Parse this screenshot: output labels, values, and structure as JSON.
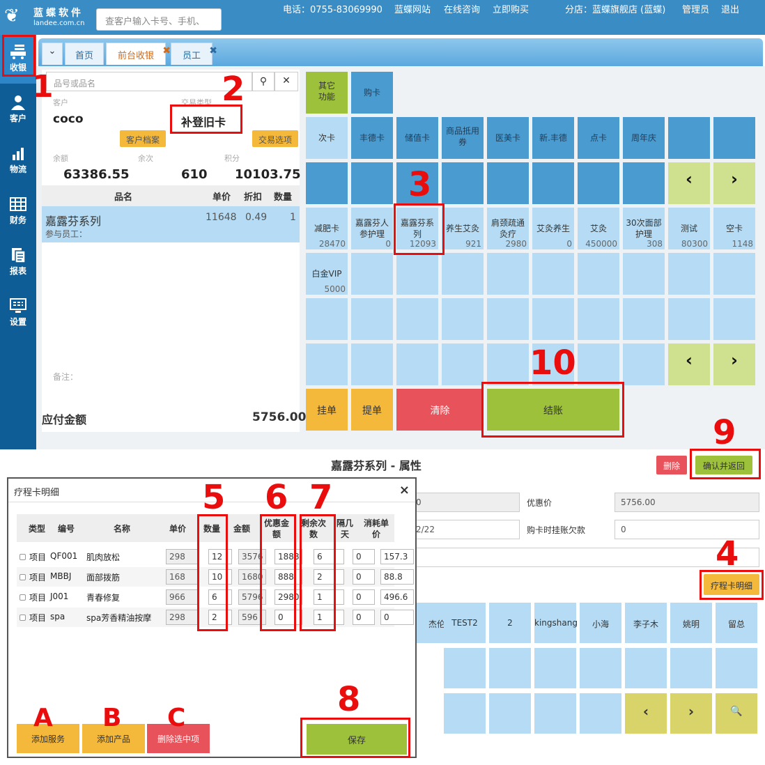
{
  "topbar": {
    "logo_cn": "蓝蝶软件",
    "logo_en": "landee.com.cn",
    "search_placeholder": "查客户输入卡号、手机、",
    "phone": "电话：0755-83069990",
    "website": "蓝蝶网站",
    "consult": "在线咨询",
    "buy": "立即购买",
    "branch": "分店：蓝蝶旗舰店 (蓝蝶)",
    "admin": "管理员",
    "logout": "退出"
  },
  "sidebar": [
    {
      "label": "收银",
      "icon": "cashier-icon"
    },
    {
      "label": "客户",
      "icon": "customer-icon"
    },
    {
      "label": "物流",
      "icon": "logistics-icon"
    },
    {
      "label": "财务",
      "icon": "finance-icon"
    },
    {
      "label": "报表",
      "icon": "report-icon"
    },
    {
      "label": "设置",
      "icon": "settings-icon"
    }
  ],
  "tabs": [
    {
      "label": "首页"
    },
    {
      "label": "前台收银"
    },
    {
      "label": "员工"
    }
  ],
  "left": {
    "search_placeholder": "品号或品名",
    "customer_label": "客户",
    "customer_name": "coco",
    "trade_type_label": "交易类型",
    "trade_type": "补登旧卡",
    "customer_file_btn": "客户档案",
    "trade_option_btn": "交易选项",
    "balance_label": "余额",
    "balance": "63386.55",
    "times_label": "余次",
    "times": "610",
    "points_label": "积分",
    "points": "10103.75",
    "col_name": "品名",
    "col_price": "单价",
    "col_discount": "折扣",
    "col_qty": "数量",
    "item_name": "嘉露芬系列",
    "item_staff": "参与员工：",
    "item_price": "11648",
    "item_discount": "0.49",
    "item_qty": "1",
    "note_label": "备注：",
    "payable_label": "应付金额",
    "payable": "5756.00"
  },
  "grid": {
    "other": "其它功能",
    "buycard": "购卡",
    "cats": [
      "次卡",
      "丰德卡",
      "储值卡",
      "商品抵用券",
      "医美卡",
      "新.丰德",
      "点卡",
      "周年庆"
    ],
    "cards": [
      {
        "name": "减肥卡",
        "count": "28470"
      },
      {
        "name": "嘉露芬人参护理",
        "count": "0"
      },
      {
        "name": "嘉露芬系列",
        "count": "12093"
      },
      {
        "name": "养生艾灸",
        "count": "921"
      },
      {
        "name": "肩颈疏通灸疗",
        "count": "2980"
      },
      {
        "name": "艾灸养生",
        "count": "0"
      },
      {
        "name": "艾灸",
        "count": "450000"
      },
      {
        "name": "30次面部护理",
        "count": "308"
      },
      {
        "name": "测试",
        "count": "80300"
      },
      {
        "name": "空卡",
        "count": "1148"
      },
      {
        "name": "白金VIP",
        "count": "5000"
      }
    ],
    "prev": "‹",
    "next": "›",
    "hold": "挂单",
    "pickup": "提单",
    "clear": "清除",
    "checkout": "结账"
  },
  "props": {
    "title": "嘉露芬系列 - 属性",
    "delete_btn": "删除",
    "confirm_btn": "确认并返回",
    "field1": "0",
    "discount_price_label": "优惠价",
    "discount_price": "5756.00",
    "date_value": "2/22",
    "debt_label": "购卡时挂账欠款",
    "debt": "0",
    "detail_btn": "疗程卡明细",
    "staff": [
      "杰伦",
      "TEST2",
      "2",
      "kingshang",
      "小海",
      "李子木",
      "姚明",
      "留总"
    ],
    "search_icon": "🔍"
  },
  "modal": {
    "title": "疗程卡明细",
    "close": "×",
    "headers": [
      "类型",
      "编号",
      "名称",
      "单价",
      "数量",
      "金额",
      "优惠金额",
      "剩余次数",
      "隔几天",
      "消耗单价"
    ],
    "rows": [
      {
        "type": "项目",
        "code": "QF001",
        "name": "肌肉放松",
        "price": "298",
        "qty": "12",
        "amount": "3576",
        "disc": "1888",
        "remain": "6",
        "gap": "0",
        "unit": "157.3"
      },
      {
        "type": "项目",
        "code": "MBBJ",
        "name": "面部拨筋",
        "price": "168",
        "qty": "10",
        "amount": "1680",
        "disc": "888",
        "remain": "2",
        "gap": "0",
        "unit": "88.8"
      },
      {
        "type": "项目",
        "code": "J001",
        "name": "青春修复",
        "price": "966",
        "qty": "6",
        "amount": "5796",
        "disc": "2980",
        "remain": "1",
        "gap": "0",
        "unit": "496.6"
      },
      {
        "type": "项目",
        "code": "spa",
        "name": "spa芳香精油按摩",
        "price": "298",
        "qty": "2",
        "amount": "596",
        "disc": "0",
        "remain": "1",
        "gap": "0",
        "unit": "0"
      }
    ],
    "add_service": "添加服务",
    "add_product": "添加产品",
    "delete_selected": "删除选中项",
    "save": "保存"
  },
  "annotations": [
    "1",
    "2",
    "3",
    "4",
    "5",
    "6",
    "7",
    "8",
    "9",
    "10",
    "A",
    "B",
    "C"
  ],
  "colors": {
    "annotation": "#ea0d0d",
    "topbar": "#3a8cc5",
    "sidebar": "#0f5d96",
    "green": "#9dc13b",
    "yellow": "#f4b83a",
    "red": "#e8525a"
  }
}
